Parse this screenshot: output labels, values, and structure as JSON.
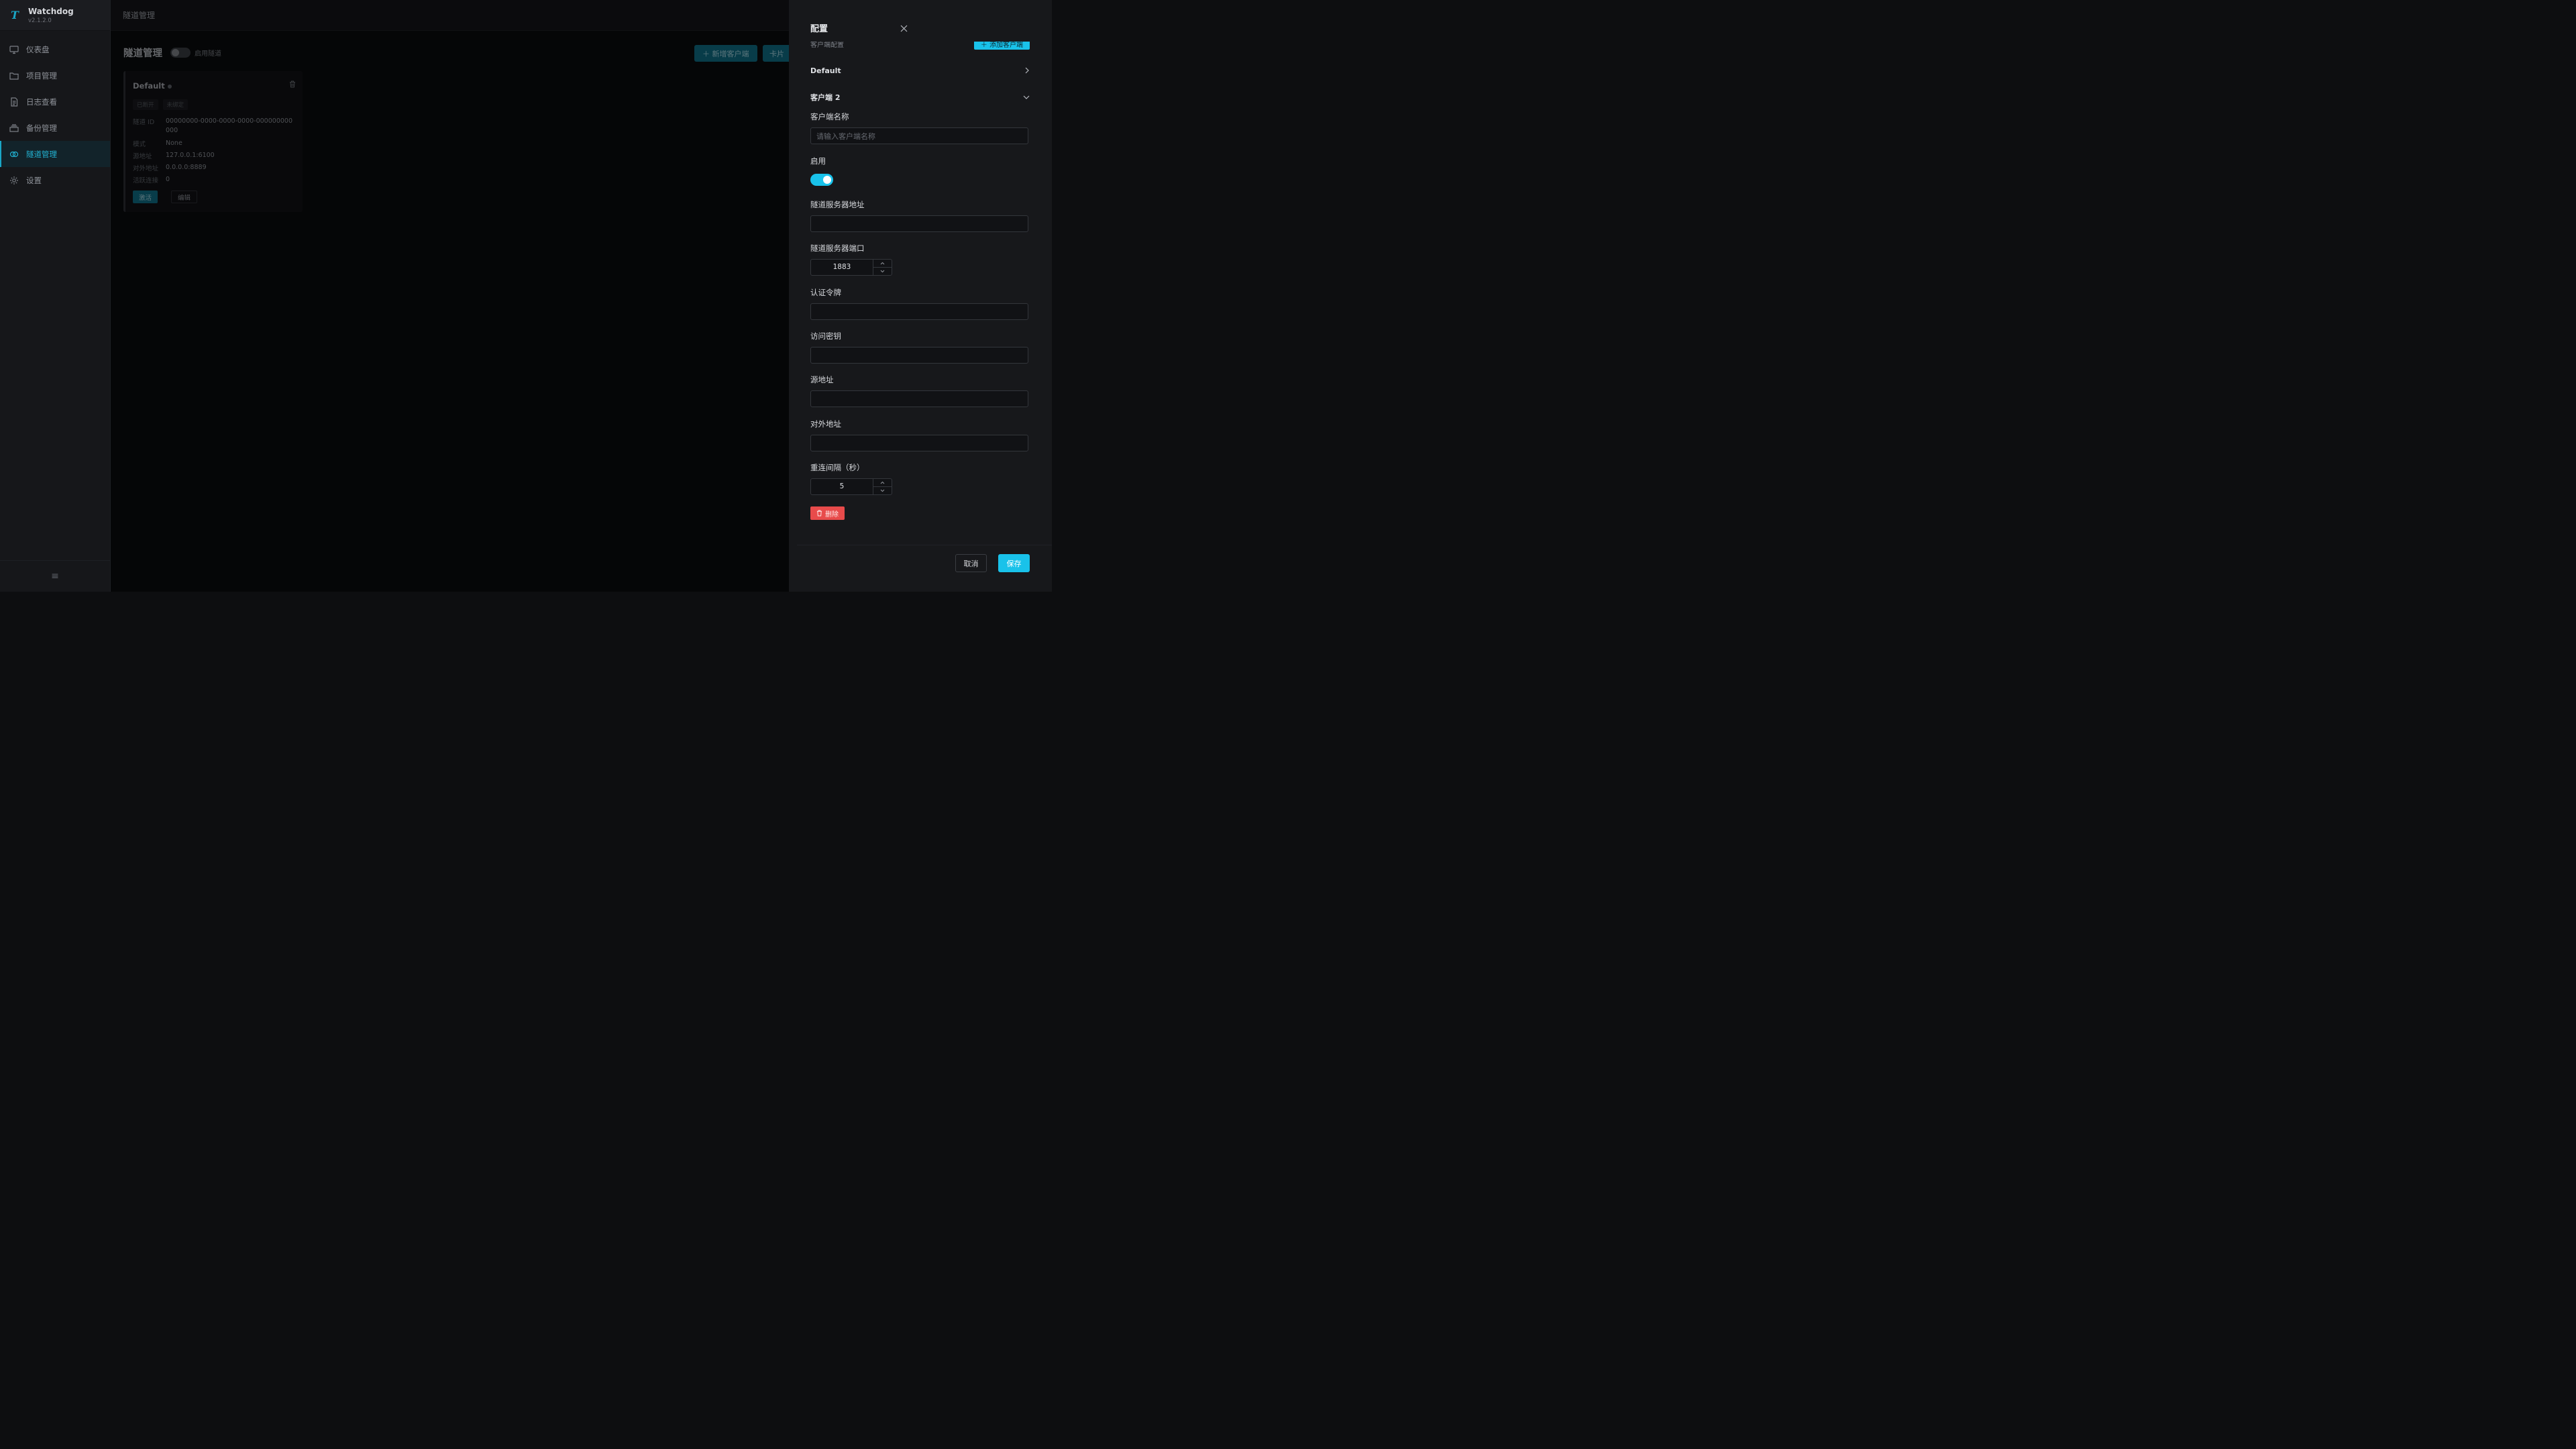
{
  "app": {
    "name": "Watchdog",
    "version": "v2.1.2.0",
    "logo_letter": "T"
  },
  "sidebar": {
    "items": [
      {
        "label": "仪表盘",
        "icon": "monitor-icon"
      },
      {
        "label": "项目管理",
        "icon": "folder-icon"
      },
      {
        "label": "日志查看",
        "icon": "document-icon"
      },
      {
        "label": "备份管理",
        "icon": "archive-icon"
      },
      {
        "label": "隧道管理",
        "icon": "tunnel-icon",
        "active": true
      },
      {
        "label": "设置",
        "icon": "gear-icon"
      }
    ],
    "collapse_glyph": "≡"
  },
  "topbar": {
    "breadcrumb": "隧道管理"
  },
  "page": {
    "title": "隧道管理",
    "enable_label": "启用隧道",
    "enable_on": false,
    "new_client_label": "＋ 新增客户端",
    "card_view_label": "卡片"
  },
  "tunnel_card": {
    "name": "Default",
    "tags": [
      "已断开",
      "未绑定"
    ],
    "fields": [
      {
        "key": "隧道 ID",
        "value": "00000000-0000-0000-0000-000000000000"
      },
      {
        "key": "模式",
        "value": "None"
      },
      {
        "key": "源地址",
        "value": "127.0.0.1:6100"
      },
      {
        "key": "对外地址",
        "value": "0.0.0.0:8889"
      },
      {
        "key": "活跃连接",
        "value": "0"
      }
    ],
    "activate_label": "激活",
    "edit_label": "编辑"
  },
  "drawer": {
    "title": "配置",
    "section_label": "客户端配置",
    "add_client_label": "＋ 添加客户端",
    "collapsed_item": "Default",
    "expanded_item": "客户端 2",
    "client_name_label": "客户端名称",
    "client_name_value": "",
    "client_name_placeholder": "请输入客户端名称",
    "enable_label": "启用",
    "enable_on": true,
    "server_addr_label": "隧道服务器地址",
    "server_addr_value": "",
    "server_port_label": "隧道服务器端口",
    "server_port_value": "1883",
    "token_label": "认证令牌",
    "token_value": "",
    "access_key_label": "访问密钥",
    "access_key_value": "",
    "source_addr_label": "源地址",
    "source_addr_value": "",
    "public_addr_label": "对外地址",
    "public_addr_value": "",
    "reconnect_label": "重连间隔（秒）",
    "reconnect_value": "5",
    "delete_label": "删除",
    "cancel_label": "取消",
    "save_label": "保存"
  },
  "colors": {
    "accent": "#19c2ea",
    "accent_dim": "#0f6d85",
    "danger": "#e84b4b",
    "background": "#0d0e10",
    "drawer_bg": "#17181b"
  }
}
